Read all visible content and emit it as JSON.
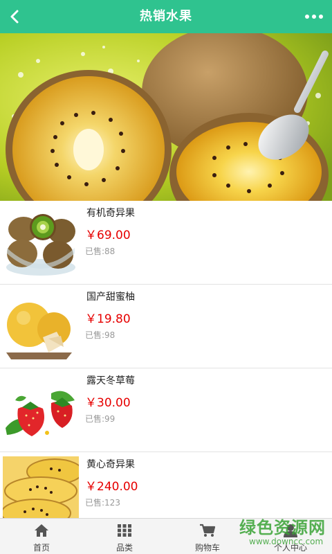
{
  "header": {
    "title": "热销水果",
    "back_icon": "chevron-left-icon",
    "more_icon": "more-dots-icon",
    "background": "#2fc38f"
  },
  "products": [
    {
      "name": "有机奇异果",
      "price": "￥69.00",
      "sold": "已售:88"
    },
    {
      "name": "国产甜蜜柚",
      "price": "￥19.80",
      "sold": "已售:98"
    },
    {
      "name": "露天冬草莓",
      "price": "￥30.00",
      "sold": "已售:99"
    },
    {
      "name": "黄心奇异果",
      "price": "￥240.00",
      "sold": "已售:123"
    }
  ],
  "tabbar": [
    {
      "label": "首页",
      "icon": "home-icon"
    },
    {
      "label": "品类",
      "icon": "grid-icon"
    },
    {
      "label": "购物车",
      "icon": "cart-icon"
    },
    {
      "label": "个人中心",
      "icon": "user-icon"
    }
  ],
  "watermark": {
    "title": "绿色资源网",
    "url": "www.downcc.com"
  },
  "colors": {
    "price": "#e60000",
    "accent": "#2fc38f"
  }
}
